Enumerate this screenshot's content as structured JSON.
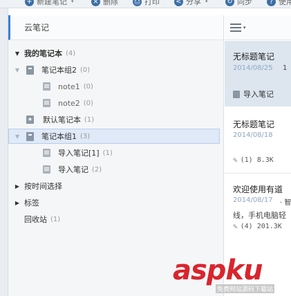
{
  "toolbar": {
    "items": [
      {
        "label": "新建笔记",
        "icon": "+",
        "caret": "▾"
      },
      {
        "label": "删除",
        "icon": "×"
      },
      {
        "label": "打印",
        "icon": "⎙"
      },
      {
        "label": "分享",
        "icon": "<",
        "caret": "▾"
      },
      {
        "label": "同步",
        "icon": "↻"
      },
      {
        "label": "使用",
        "icon": "?"
      }
    ]
  },
  "sidebar": {
    "title": "云笔记",
    "tree": [
      {
        "label": "我的笔记本",
        "count": "(4)",
        "arrow": "▼",
        "icon": "none"
      },
      {
        "label": "笔记本组2",
        "count": "(0)",
        "arrow": "▼",
        "icon": "notebook"
      },
      {
        "label": "note1",
        "count": "(0)",
        "arrow": "",
        "icon": "note"
      },
      {
        "label": "note2",
        "count": "(0)",
        "arrow": "",
        "icon": "note"
      },
      {
        "label": "默认笔记本",
        "count": "(1)",
        "arrow": "",
        "icon": "star"
      },
      {
        "label": "笔记本组1",
        "count": "(3)",
        "arrow": "▼",
        "icon": "notebook",
        "selected": true
      },
      {
        "label": "导入笔记[1]",
        "count": "(1)",
        "arrow": "",
        "icon": "note"
      },
      {
        "label": "导入笔记",
        "count": "(2)",
        "arrow": "",
        "icon": "note"
      },
      {
        "label": "按时间选择",
        "count": "",
        "arrow": "▶",
        "icon": "none"
      },
      {
        "label": "标签",
        "count": "",
        "arrow": "▶",
        "icon": "none"
      },
      {
        "label": "回收站",
        "count": "(1)",
        "arrow": "",
        "icon": "none"
      }
    ]
  },
  "notes": [
    {
      "title": "无标题笔记",
      "date": "2014/08/25",
      "extra": "1",
      "tag": "导入笔记"
    },
    {
      "title": "无标题笔记",
      "date": "2014/08/18",
      "meta": "(1) 8.3K"
    },
    {
      "title": "欢迎使用有道",
      "date": "2014/08/17",
      "extra": "· 智",
      "line": "线，手机电脑轻",
      "meta": "(4) 201.3K"
    }
  ],
  "watermark": {
    "text": "aspku",
    "sub": "免费网站源码下载站"
  }
}
